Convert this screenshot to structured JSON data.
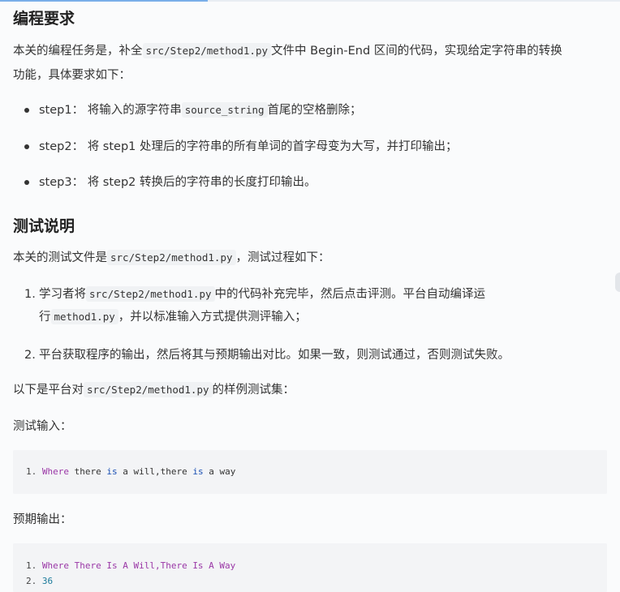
{
  "sections": {
    "requirements": {
      "title": "编程要求",
      "intro_a": "本关的编程任务是，补全",
      "intro_code": "src/Step2/method1.py",
      "intro_b": "文件中 Begin-End 区间的代码，实现给定字符串的转换",
      "intro_c": "功能，具体要求如下：",
      "steps": [
        {
          "label": "step1：",
          "text_a": "将输入的源字符串",
          "code": "source_string",
          "text_b": "首尾的空格删除；"
        },
        {
          "label": "step2：",
          "text_a": "将 step1 处理后的字符串的所有单词的首字母变为大写，并打印输出；"
        },
        {
          "label": "step3：",
          "text_a": "将 step2 转换后的字符串的长度打印输出。"
        }
      ]
    },
    "testing": {
      "title": "测试说明",
      "intro_a": "本关的测试文件是",
      "intro_code": "src/Step2/method1.py",
      "intro_b": "，测试过程如下：",
      "item1_num": "1.",
      "item1_a": "学习者将",
      "item1_code": "src/Step2/method1.py",
      "item1_b": "中的代码补充完毕，然后点击评测。平台自动编译运",
      "item1_c": "行",
      "item1_code2": "method1.py",
      "item1_d": "，并以标准输入方式提供测评输入；",
      "item2_num": "2.",
      "item2_text": "平台获取程序的输出，然后将其与预期输出对比。如果一致，则测试通过，否则测试失败。",
      "sample_a": "以下是平台对",
      "sample_code": "src/Step2/method1.py",
      "sample_b": "的样例测试集：",
      "input_label": "测试输入：",
      "input_lines": [
        {
          "ln": "1.",
          "tokens": [
            "Where",
            " there ",
            "is",
            " a will,there ",
            "is",
            " a way"
          ]
        }
      ],
      "output_label": "预期输出：",
      "output_lines": [
        {
          "ln": "1.",
          "tokens": [
            "Where There Is A Will,",
            "There Is A Way"
          ]
        },
        {
          "ln": "2.",
          "value": "36"
        }
      ]
    }
  }
}
